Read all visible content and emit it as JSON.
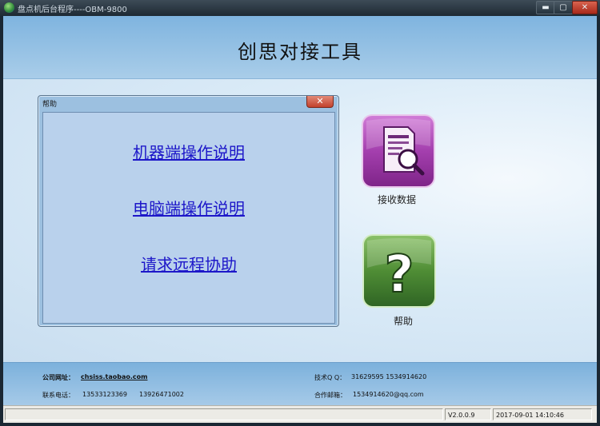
{
  "window": {
    "title": "盘点机后台程序----OBM-9800",
    "minimize_symbol": "▬",
    "maximize_symbol": "▢",
    "close_symbol": "✕"
  },
  "header": {
    "title": "创思对接工具"
  },
  "help_dialog": {
    "title": "帮助",
    "close_symbol": "✕",
    "links": [
      "机器端操作说明",
      "电脑端操作说明",
      "请求远程协助"
    ]
  },
  "features": [
    {
      "label": "接收数据",
      "icon": "receive-data-icon",
      "color": "#9b3ea6"
    },
    {
      "label": "帮助",
      "icon": "help-icon",
      "color": "#3f7b2f"
    }
  ],
  "footer": {
    "website_label": "公司网址：",
    "website_value": "chsiss.taobao.com",
    "phone_label": "联系电话：",
    "phone_1": "13533123369",
    "phone_2": "13926471002",
    "qq_label": "技术Q Q：",
    "qq_value": "31629595  1534914620",
    "email_label": "合作邮箱：",
    "email_value": "1534914620@qq.com"
  },
  "status": {
    "version": "V2.0.0.9",
    "datetime": "2017-09-01  14:10:46"
  }
}
